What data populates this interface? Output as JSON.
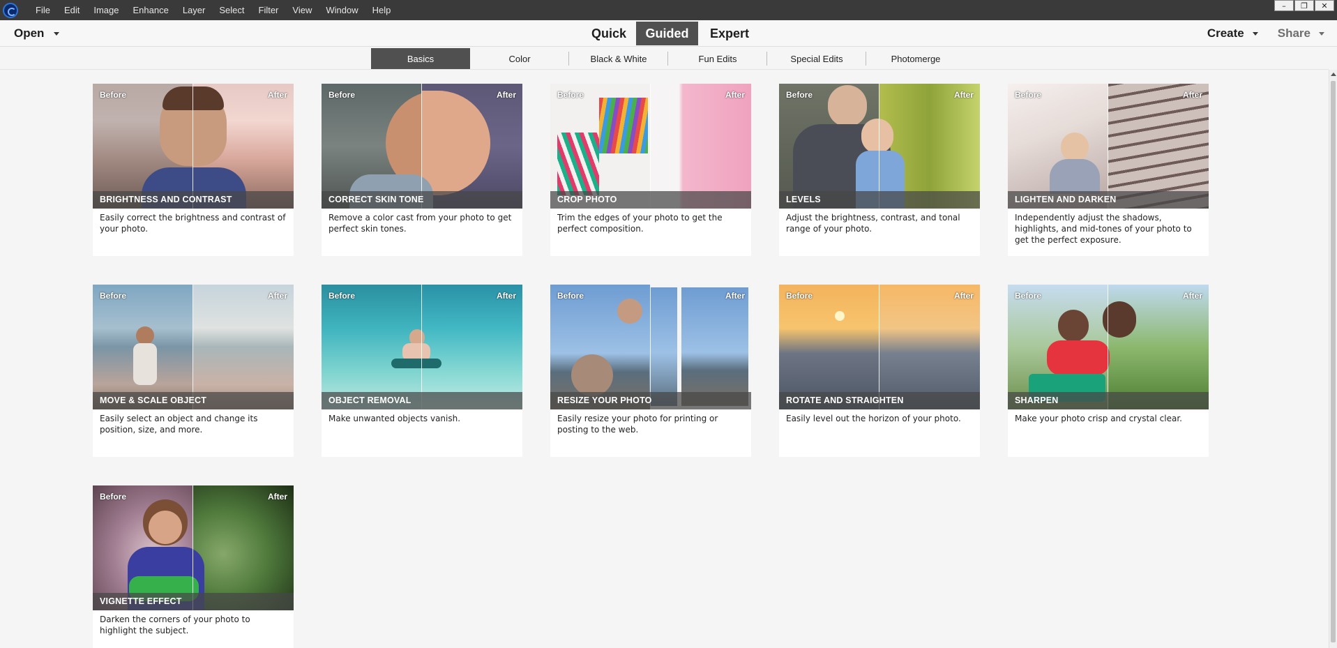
{
  "menubar": {
    "items": [
      "File",
      "Edit",
      "Image",
      "Enhance",
      "Layer",
      "Select",
      "Filter",
      "View",
      "Window",
      "Help"
    ],
    "window_controls": [
      "–",
      "❐",
      "✕"
    ]
  },
  "modebar": {
    "open_label": "Open",
    "modes": [
      "Quick",
      "Guided",
      "Expert"
    ],
    "active_mode": "Guided",
    "create_label": "Create",
    "share_label": "Share"
  },
  "tabs": {
    "items": [
      "Basics",
      "Color",
      "Black & White",
      "Fun Edits",
      "Special Edits",
      "Photomerge"
    ],
    "active": "Basics"
  },
  "labels": {
    "before": "Before",
    "after": "After"
  },
  "cards": [
    {
      "title": "BRIGHTNESS AND CONTRAST",
      "desc": "Easily correct the brightness and contrast of your photo."
    },
    {
      "title": "CORRECT SKIN TONE",
      "desc": "Remove a color cast from your photo to get perfect skin tones."
    },
    {
      "title": "CROP PHOTO",
      "desc": "Trim the edges of your photo to get the perfect composition."
    },
    {
      "title": "LEVELS",
      "desc": "Adjust the brightness, contrast, and tonal range of your photo."
    },
    {
      "title": "LIGHTEN AND DARKEN",
      "desc": "Independently adjust the shadows, highlights, and mid-tones of your photo to get the perfect exposure."
    },
    {
      "title": "MOVE & SCALE OBJECT",
      "desc": "Easily select an object and change its position, size, and more."
    },
    {
      "title": "OBJECT REMOVAL",
      "desc": "Make unwanted objects vanish."
    },
    {
      "title": "RESIZE YOUR PHOTO",
      "desc": "Easily resize your photo for printing or posting to the web."
    },
    {
      "title": "ROTATE AND STRAIGHTEN",
      "desc": "Easily level out the horizon of your photo."
    },
    {
      "title": "SHARPEN",
      "desc": "Make your photo crisp and crystal clear."
    },
    {
      "title": "VIGNETTE EFFECT",
      "desc": "Darken the corners of your photo to highlight the subject."
    }
  ],
  "colors": {
    "menubar_bg": "#3a3a3a",
    "active_tab_bg": "#505050",
    "page_bg": "#f5f5f5"
  }
}
